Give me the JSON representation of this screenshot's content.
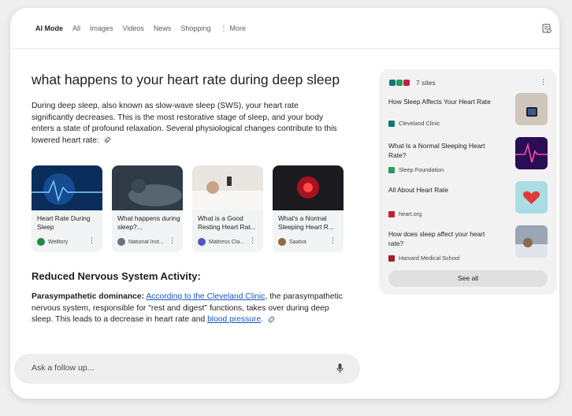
{
  "nav": {
    "tabs": [
      "AI Mode",
      "All",
      "Images",
      "Videos",
      "News",
      "Shopping"
    ],
    "more_label": "More"
  },
  "question": "what happens to your heart rate during deep sleep",
  "answer": "During deep sleep, also known as slow-wave sleep (SWS), your heart rate significantly decreases. This is the most restorative stage of sleep, and your body enters a state of profound relaxation. Several physiological changes contribute to this lowered heart rate:",
  "cards": [
    {
      "title": "Heart Rate During Sleep",
      "source": "Welltory",
      "icon_color": "#1e8e3e"
    },
    {
      "title": "What happens during sleep?...",
      "source": "National Inst...",
      "icon_color": "#6b7280"
    },
    {
      "title": "What is a Good Resting Heart Rat...",
      "source": "Mattress Cla...",
      "icon_color": "#4b5bb5"
    },
    {
      "title": "What's a Normal Sleeping Heart R...",
      "source": "Saatva",
      "icon_color": "#8a6d3b"
    }
  ],
  "section": {
    "heading": "Reduced Nervous System Activity:",
    "lead": "Parasympathetic dominance:",
    "link1": "According to the Cleveland Clinic",
    "mid": ", the parasympathetic nervous system, responsible for \"rest and digest\" functions, takes over during deep sleep. This leads to a decrease in heart rate and ",
    "link2": "blood pressure",
    "tail": "."
  },
  "ask": {
    "placeholder": "Ask a follow up..."
  },
  "sources": {
    "count_label": "7 sites",
    "items": [
      {
        "title": "How Sleep Affects Your Heart Rate",
        "site": "Cleveland Clinic",
        "icon_color": "#0b7a75"
      },
      {
        "title": "What Is a Normal Sleeping Heart Rate?",
        "site": "Sleep Foundation",
        "icon_color": "#2e9a5e"
      },
      {
        "title": "All About Heart Rate",
        "site": "heart.org",
        "icon_color": "#c41e3a"
      },
      {
        "title": "How does sleep affect your heart rate?",
        "site": "Harvard Medical School",
        "icon_color": "#a51c30"
      }
    ],
    "see_all": "See all"
  }
}
